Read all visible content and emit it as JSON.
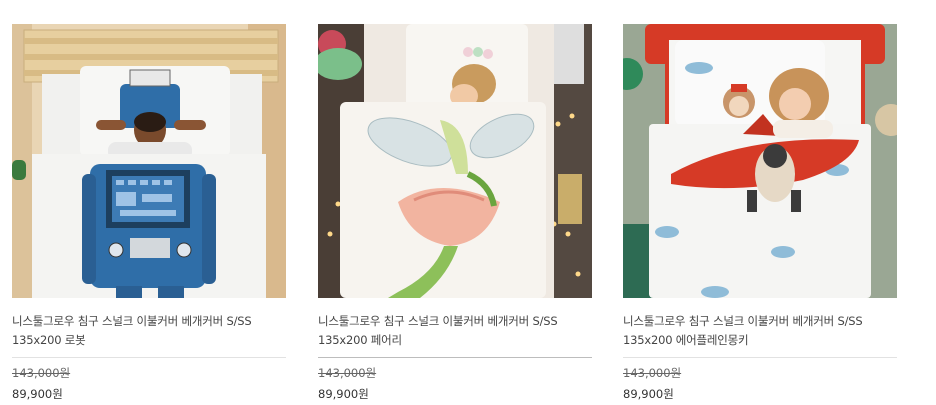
{
  "products": [
    {
      "name": "니스툴그로우 침구 스널크 이불커버 베개커버 S/SS\n135x200 로봇",
      "original_price": "143,000원",
      "price": "89,900원",
      "image": "robot-duvet-photo"
    },
    {
      "name": "니스툴그로우 침구 스널크 이불커버 베개커버 S/SS\n135x200 페어리",
      "original_price": "143,000원",
      "price": "89,900원",
      "image": "fairy-duvet-photo"
    },
    {
      "name": "니스툴그로우 침구 스널크 이불커버 베개커버 S/SS\n135x200 에어플레인몽키",
      "original_price": "143,000원",
      "price": "89,900원",
      "image": "airplane-monkey-duvet-photo"
    }
  ]
}
